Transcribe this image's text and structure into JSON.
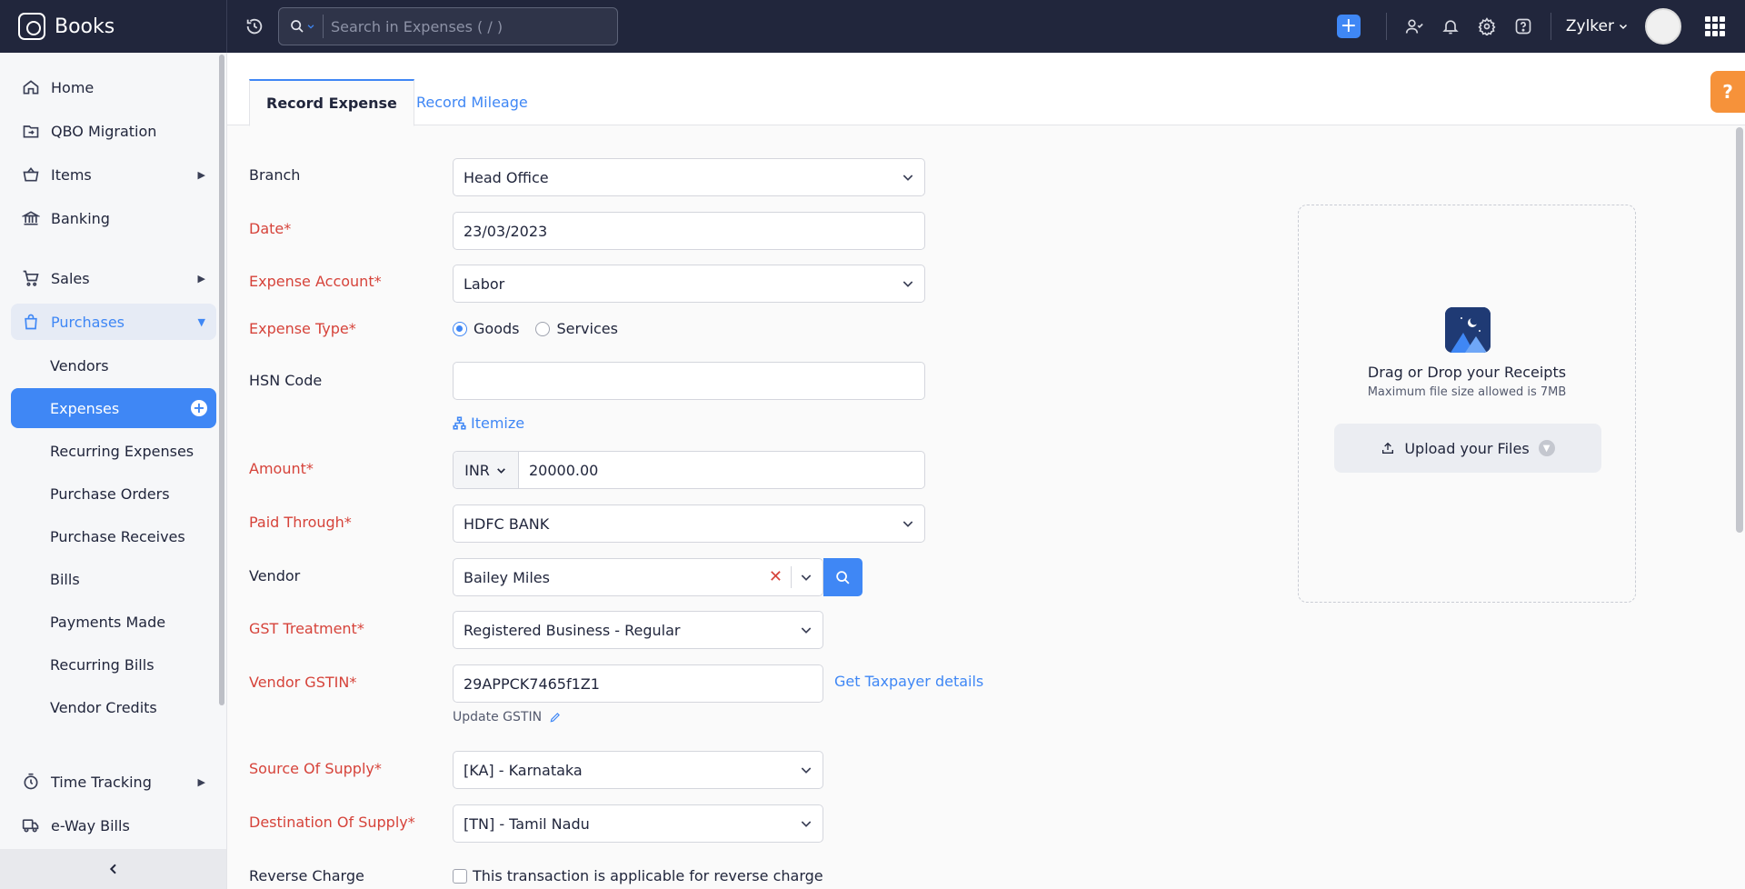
{
  "app": {
    "name": "Books"
  },
  "search": {
    "placeholder": "Search in Expenses ( / )"
  },
  "topbar": {
    "org_name": "Zylker"
  },
  "sidebar": {
    "items": [
      {
        "label": "Home"
      },
      {
        "label": "QBO Migration"
      },
      {
        "label": "Items"
      },
      {
        "label": "Banking"
      },
      {
        "label": "Sales"
      },
      {
        "label": "Purchases"
      },
      {
        "label": "Time Tracking"
      },
      {
        "label": "e-Way Bills"
      }
    ],
    "purchases_sub": [
      {
        "label": "Vendors"
      },
      {
        "label": "Expenses"
      },
      {
        "label": "Recurring Expenses"
      },
      {
        "label": "Purchase Orders"
      },
      {
        "label": "Purchase Receives"
      },
      {
        "label": "Bills"
      },
      {
        "label": "Payments Made"
      },
      {
        "label": "Recurring Bills"
      },
      {
        "label": "Vendor Credits"
      }
    ]
  },
  "tabs": [
    {
      "label": "Record Expense"
    },
    {
      "label": "Record Mileage"
    }
  ],
  "form": {
    "branch": {
      "label": "Branch",
      "value": "Head Office"
    },
    "date": {
      "label": "Date*",
      "value": "23/03/2023"
    },
    "expense_account": {
      "label": "Expense Account*",
      "value": "Labor"
    },
    "expense_type": {
      "label": "Expense Type*",
      "options": [
        "Goods",
        "Services"
      ],
      "selected": "Goods"
    },
    "hsn_code": {
      "label": "HSN Code",
      "value": ""
    },
    "itemize": {
      "label": "Itemize"
    },
    "amount": {
      "label": "Amount*",
      "currency": "INR",
      "value": "20000.00"
    },
    "paid_through": {
      "label": "Paid Through*",
      "value": "HDFC BANK"
    },
    "vendor": {
      "label": "Vendor",
      "value": "Bailey Miles"
    },
    "gst_treatment": {
      "label": "GST Treatment*",
      "value": "Registered Business - Regular"
    },
    "vendor_gstin": {
      "label": "Vendor GSTIN*",
      "value": "29APPCK7465f1Z1",
      "taxpayer_link": "Get Taxpayer details",
      "update_label": "Update GSTIN"
    },
    "source_of_supply": {
      "label": "Source Of Supply*",
      "value": "[KA] - Karnataka"
    },
    "destination_of_supply": {
      "label": "Destination Of Supply*",
      "value": "[TN] - Tamil Nadu"
    },
    "reverse_charge": {
      "label": "Reverse Charge",
      "checkbox_label": "This transaction is applicable for reverse charge",
      "checked": false
    }
  },
  "receipts": {
    "title": "Drag or Drop your Receipts",
    "subtitle": "Maximum file size allowed is 7MB",
    "upload_label": "Upload your Files"
  },
  "help": {
    "label": "?"
  },
  "colors": {
    "accent": "#3f87f5",
    "topbar": "#21263c",
    "required": "#d6433a",
    "help_tab": "#f6923a"
  }
}
